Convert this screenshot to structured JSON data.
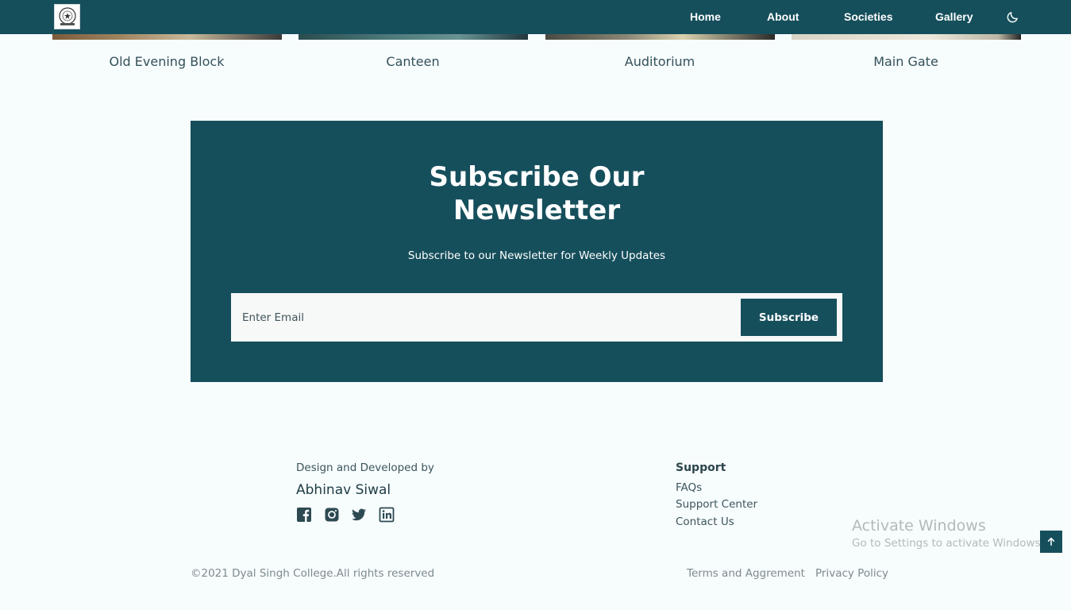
{
  "nav": {
    "items": [
      {
        "label": "Home"
      },
      {
        "label": "About"
      },
      {
        "label": "Societies"
      },
      {
        "label": "Gallery"
      }
    ],
    "theme_icon": "moon-icon"
  },
  "gallery": {
    "captions": [
      "Old Evening Block",
      "Canteen",
      "Auditorium",
      "Main Gate"
    ]
  },
  "newsletter": {
    "title_line1": "Subscribe Our",
    "title_line2": "Newsletter",
    "subtitle": "Subscribe to our Newsletter for Weekly Updates",
    "email_placeholder": "Enter Email",
    "button_label": "Subscribe"
  },
  "footer": {
    "credit_label": "Design and Developed by",
    "author": "Abhinav Siwal",
    "social_icons": [
      "facebook-icon",
      "instagram-icon",
      "twitter-icon",
      "linkedin-icon"
    ],
    "support": {
      "title": "Support",
      "links": [
        "FAQs",
        "Support Center",
        "Contact Us"
      ]
    },
    "copyright": "©2021 Dyal Singh College.All rights reserved",
    "legal": [
      "Terms and Aggrement",
      "Privacy Policy"
    ]
  },
  "windows_watermark": {
    "title": "Activate Windows",
    "subtitle": "Go to Settings to activate Windows."
  },
  "colors": {
    "primary": "#164f5c",
    "background": "#f7fcfd"
  }
}
